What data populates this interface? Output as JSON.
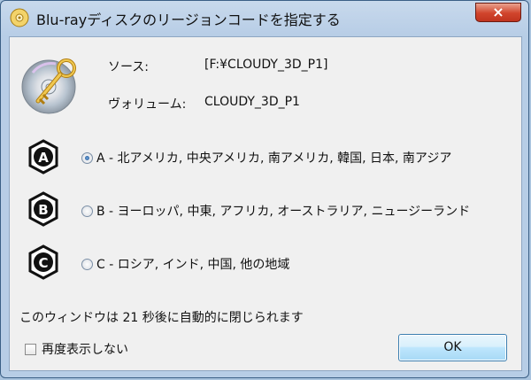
{
  "window": {
    "title": "Blu-rayディスクのリージョンコードを指定する",
    "close_label": "×"
  },
  "info": {
    "source_label": "ソース:",
    "source_value": "[F:¥CLOUDY_3D_P1]",
    "volume_label": "ヴォリューム:",
    "volume_value": "CLOUDY_3D_P1"
  },
  "regions": [
    {
      "letter": "A",
      "label": "A - 北アメリカ, 中央アメリカ, 南アメリカ, 韓国, 日本, 南アジア",
      "selected": true
    },
    {
      "letter": "B",
      "label": "B - ヨーロッパ, 中東, アフリカ, オーストラリア, ニュージーランド",
      "selected": false
    },
    {
      "letter": "C",
      "label": "C - ロシア, インド, 中国, 他の地域",
      "selected": false
    }
  ],
  "countdown_text": "このウィンドウは 21 秒後に自動的に閉じられます",
  "dont_show_again": {
    "label": "再度表示しない",
    "checked": false
  },
  "ok_label": "OK"
}
